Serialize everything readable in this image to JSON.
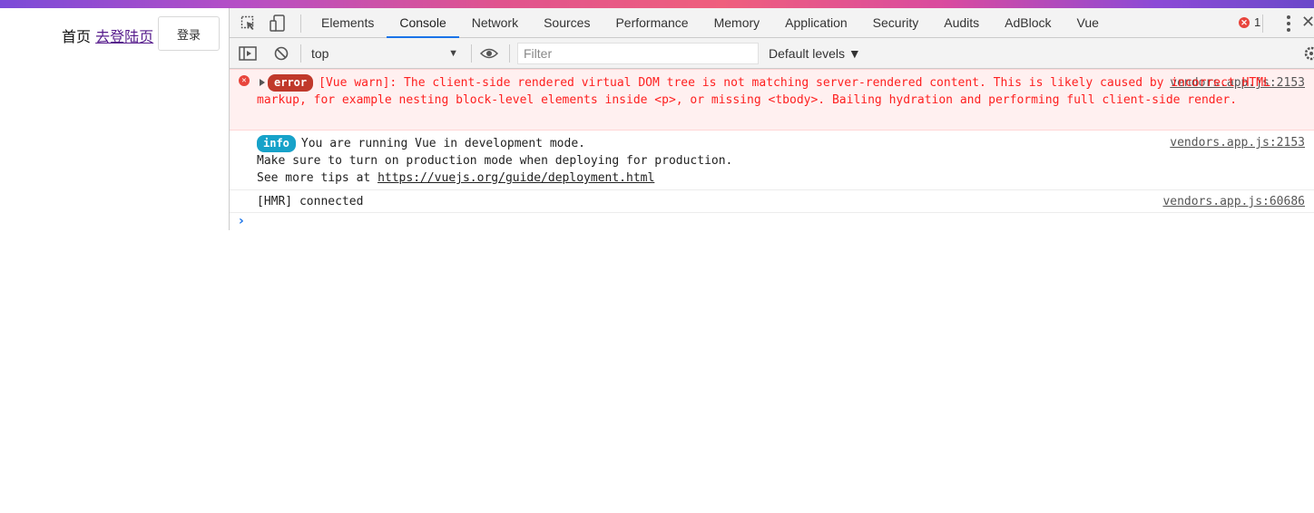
{
  "page": {
    "nav_home": "首页",
    "nav_login_link": "去登陆页",
    "login_button": "登录"
  },
  "devtools": {
    "tabs": [
      {
        "label": "Elements"
      },
      {
        "label": "Console",
        "active": true
      },
      {
        "label": "Network"
      },
      {
        "label": "Sources"
      },
      {
        "label": "Performance"
      },
      {
        "label": "Memory"
      },
      {
        "label": "Application"
      },
      {
        "label": "Security"
      },
      {
        "label": "Audits"
      },
      {
        "label": "AdBlock"
      },
      {
        "label": "Vue"
      }
    ],
    "error_count": "1",
    "toolbar": {
      "context": "top",
      "filter_placeholder": "Filter",
      "levels": "Default levels ▼"
    },
    "messages": {
      "error": {
        "badge": "error",
        "text": "[Vue warn]: The client-side rendered virtual DOM tree is not matching server-rendered content. This is likely caused by incorrect HTML markup, for example nesting block-level elements inside <p>, or missing <tbody>. Bailing hydration and performing full client-side render.",
        "source": "vendors.app.js:2153"
      },
      "info": {
        "badge": "info",
        "line1": "You are running Vue in development mode.",
        "line2": "Make sure to turn on production mode when deploying for production.",
        "line3_prefix": "See more tips at ",
        "link": "https://vuejs.org/guide/deployment.html",
        "source": "vendors.app.js:2153"
      },
      "hmr": {
        "text": "[HMR] connected",
        "source": "vendors.app.js:60686"
      }
    },
    "prompt": "›"
  },
  "colors": {
    "accent": "#1a73e8",
    "error_text": "#fe2020",
    "error_bg": "#fff0f0",
    "error_badge": "#c0392b",
    "info_badge": "#17a2c9"
  }
}
